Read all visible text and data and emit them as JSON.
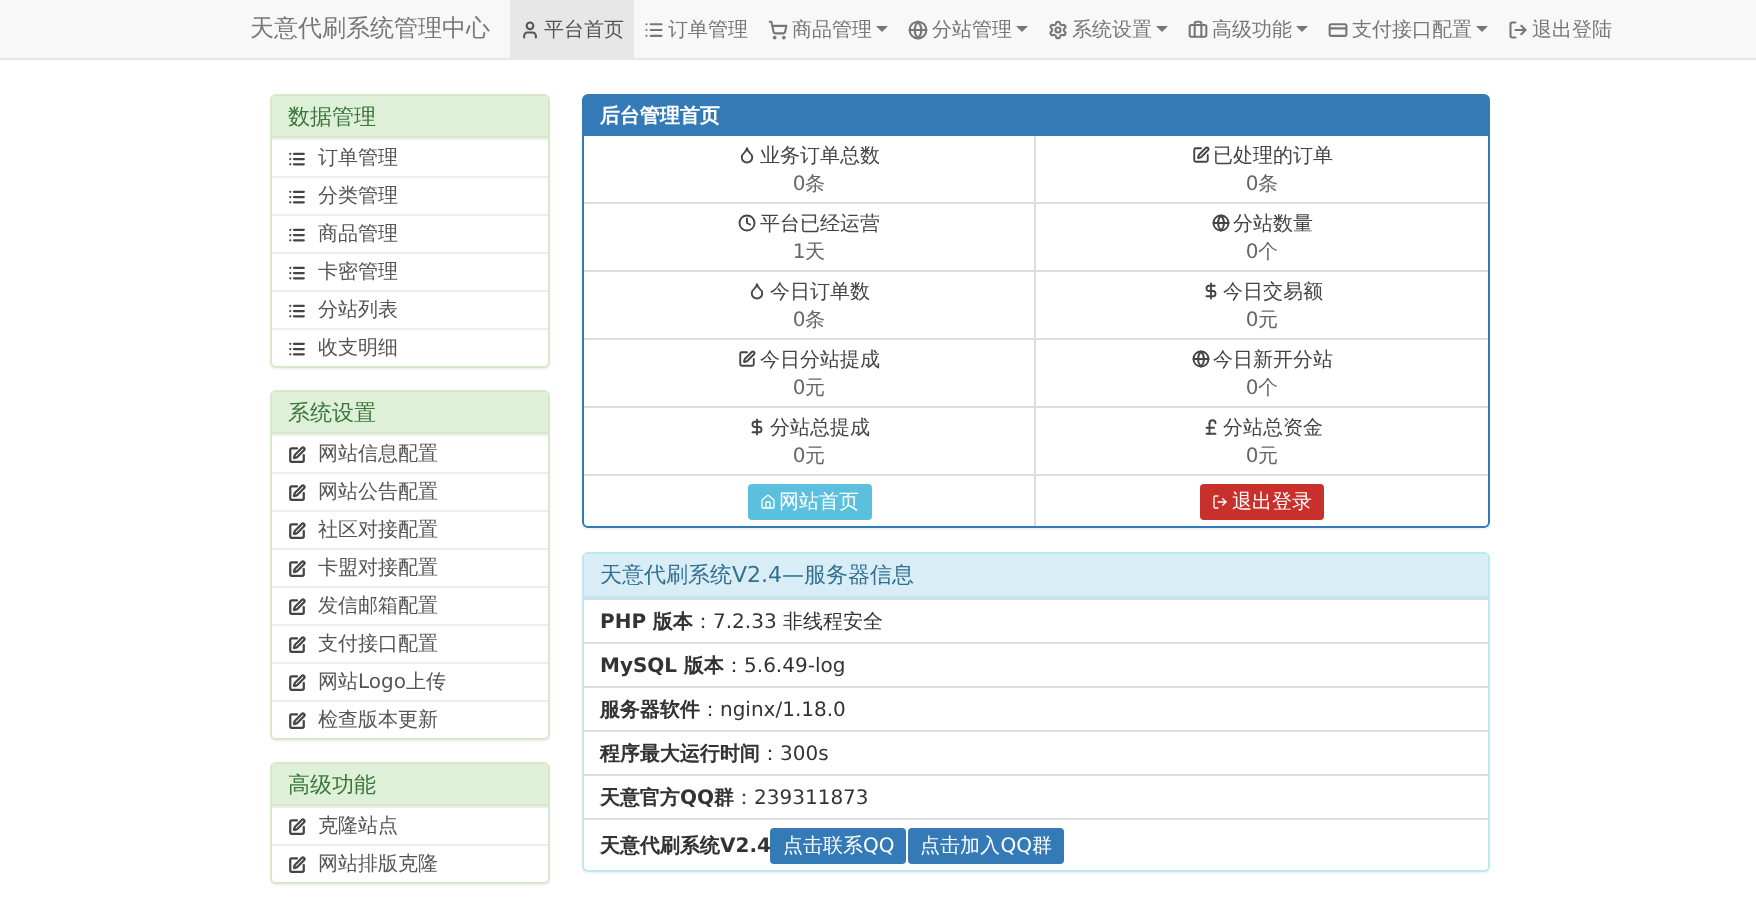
{
  "navbar": {
    "brand": "天意代刷系统管理中心",
    "items": [
      {
        "label": "平台首页",
        "selected": true,
        "dropdown": false
      },
      {
        "label": "订单管理",
        "selected": false,
        "dropdown": false
      },
      {
        "label": "商品管理",
        "selected": false,
        "dropdown": true
      },
      {
        "label": "分站管理",
        "selected": false,
        "dropdown": true
      },
      {
        "label": "系统设置",
        "selected": false,
        "dropdown": true
      },
      {
        "label": "高级功能",
        "selected": false,
        "dropdown": true
      },
      {
        "label": "支付接口配置",
        "selected": false,
        "dropdown": true
      },
      {
        "label": "退出登陆",
        "selected": false,
        "dropdown": false
      }
    ]
  },
  "sidebar": [
    {
      "title": "数据管理",
      "items": [
        "订单管理",
        "分类管理",
        "商品管理",
        "卡密管理",
        "分站列表",
        "收支明细"
      ]
    },
    {
      "title": "系统设置",
      "items": [
        "网站信息配置",
        "网站公告配置",
        "社区对接配置",
        "卡盟对接配置",
        "发信邮箱配置",
        "支付接口配置",
        "网站Logo上传",
        "检查版本更新"
      ]
    },
    {
      "title": "高级功能",
      "items": [
        "克隆站点",
        "网站排版克隆"
      ]
    }
  ],
  "dashboard": {
    "title": "后台管理首页",
    "stats": [
      {
        "label": "业务订单总数",
        "value": "0条"
      },
      {
        "label": "已处理的订单",
        "value": "0条"
      },
      {
        "label": "平台已经运营",
        "value": "1天"
      },
      {
        "label": "分站数量",
        "value": "0个"
      },
      {
        "label": "今日订单数",
        "value": "0条"
      },
      {
        "label": "今日交易额",
        "value": "0元"
      },
      {
        "label": "今日分站提成",
        "value": "0元"
      },
      {
        "label": "今日新开分站",
        "value": "0个"
      },
      {
        "label": "分站总提成",
        "value": "0元"
      },
      {
        "label": "分站总资金",
        "value": "0元"
      }
    ],
    "buttons": [
      {
        "label": "网站首页",
        "kind": "info"
      },
      {
        "label": "退出登录",
        "kind": "danger"
      }
    ]
  },
  "server": {
    "title": "天意代刷系统V2.4—服务器信息",
    "rows": [
      "**PHP 版本**：7.2.33 非线程安全",
      "**MySQL 版本**：5.6.49-log",
      "**服务器软件**：nginx/1.18.0",
      "**程序最大运行时间**：300s",
      "**天意官方QQ群**：239311873"
    ],
    "footer": {
      "label": "天意代刷系统V2.4",
      "buttons": [
        "点击联系QQ",
        "点击加入QQ群"
      ]
    }
  }
}
